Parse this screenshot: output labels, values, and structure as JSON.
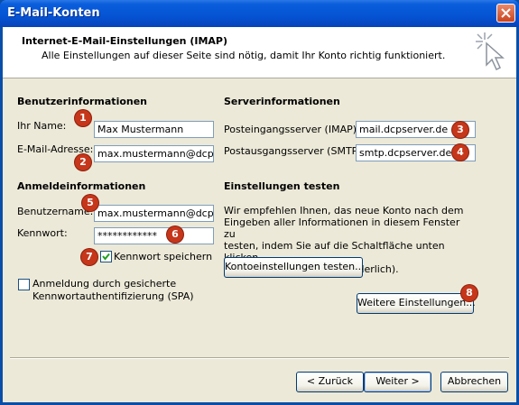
{
  "window": {
    "title": "E-Mail-Konten"
  },
  "header": {
    "title": "Internet-E-Mail-Einstellungen (IMAP)",
    "subtitle": "Alle Einstellungen auf dieser Seite sind nötig, damit Ihr Konto richtig funktioniert."
  },
  "user_info": {
    "heading": "Benutzerinformationen",
    "name_label": "Ihr Name:",
    "name_value": "Max Mustermann",
    "email_label": "E-Mail-Adresse:",
    "email_value": "max.mustermann@dcp-server.de"
  },
  "server_info": {
    "heading": "Serverinformationen",
    "incoming_label": "Posteingangsserver (IMAP):",
    "incoming_value": "mail.dcpserver.de",
    "outgoing_label": "Postausgangsserver (SMTP):",
    "outgoing_value": "smtp.dcpserver.de"
  },
  "login_info": {
    "heading": "Anmeldeinformationen",
    "user_label": "Benutzername:",
    "user_value": "max.mustermann@dcp-server.de",
    "password_label": "Kennwort:",
    "password_value": "************",
    "remember_label": "Kennwort speichern",
    "remember_checked": true,
    "spa_label_line1": "Anmeldung durch gesicherte",
    "spa_label_line2": "Kennwortauthentifizierung (SPA)",
    "spa_checked": false
  },
  "test": {
    "heading": "Einstellungen testen",
    "text_line1": "Wir empfehlen Ihnen, das neue Konto nach dem",
    "text_line2": "Eingeben aller Informationen in diesem Fenster zu",
    "text_line3": "testen, indem Sie auf die Schaltfläche unten klicken",
    "text_line4": "(Netzwerkverbindung erforderlich).",
    "test_button": "Kontoeinstellungen testen..."
  },
  "more_settings_button": "Weitere Einstellungen...",
  "footer": {
    "back_button": "< Zurück",
    "next_button": "Weiter >",
    "cancel_button": "Abbrechen"
  },
  "badges": [
    "1",
    "2",
    "3",
    "4",
    "5",
    "6",
    "7",
    "8"
  ],
  "colors": {
    "badge": "#c6361b",
    "titlebar": "#0554d4",
    "dialog_bg": "#ece9d8"
  },
  "icons": {
    "close": "close-icon",
    "wizard": "cursor-click-icon",
    "check": "checkmark-icon"
  }
}
